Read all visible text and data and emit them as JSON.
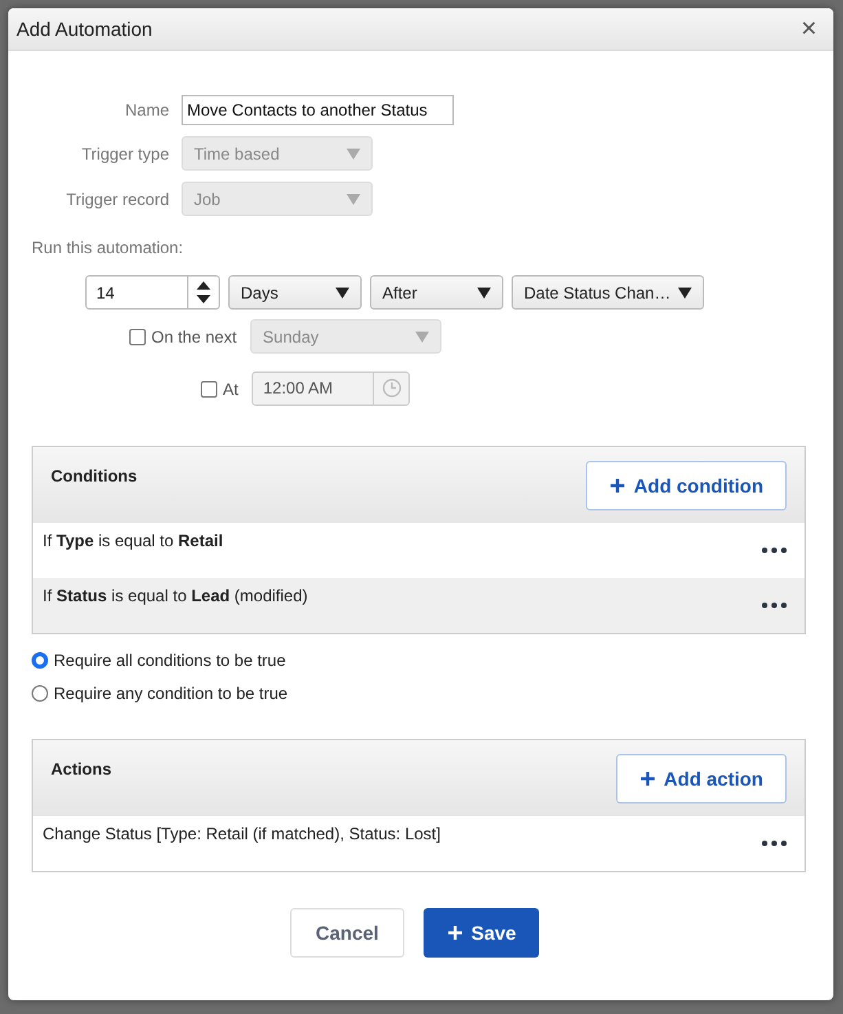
{
  "window": {
    "title": "Add Automation",
    "close": "×"
  },
  "fields": [
    {
      "kind": "text",
      "label": "Name",
      "value": "Move Contacts to another Status"
    },
    {
      "kind": "select",
      "label": "Trigger type",
      "value": "Time based",
      "disabled": true
    },
    {
      "kind": "select",
      "label": "Trigger record",
      "value": "Job",
      "disabled": true
    }
  ],
  "run_label": "Run this automation:",
  "schedule": {
    "amount": "14",
    "unit": "Days",
    "relation": "After",
    "date_field": "Date Status Chan…"
  },
  "on_next": {
    "label": "On the next",
    "checked": false,
    "value": "Sunday",
    "disabled": true
  },
  "at": {
    "label": "At",
    "checked": false,
    "value": "12:00 AM",
    "disabled": true
  },
  "conditions": {
    "title": "Conditions",
    "add_button": "Add condition",
    "rows": [
      {
        "text": "If **Type** is equal to **Retail**"
      },
      {
        "text": "If **Status** is equal to **Lead** (modified)"
      }
    ]
  },
  "match_mode": [
    {
      "label": "Require all conditions to be true",
      "selected": true
    },
    {
      "label": "Require any condition to be true",
      "selected": false
    }
  ],
  "actions": {
    "title": "Actions",
    "add_button": "Add action",
    "rows": [
      {
        "text": "Change Status [Type: Retail (if matched), Status: Lost]"
      }
    ]
  },
  "buttons": {
    "cancel": "Cancel",
    "save": "Save"
  }
}
